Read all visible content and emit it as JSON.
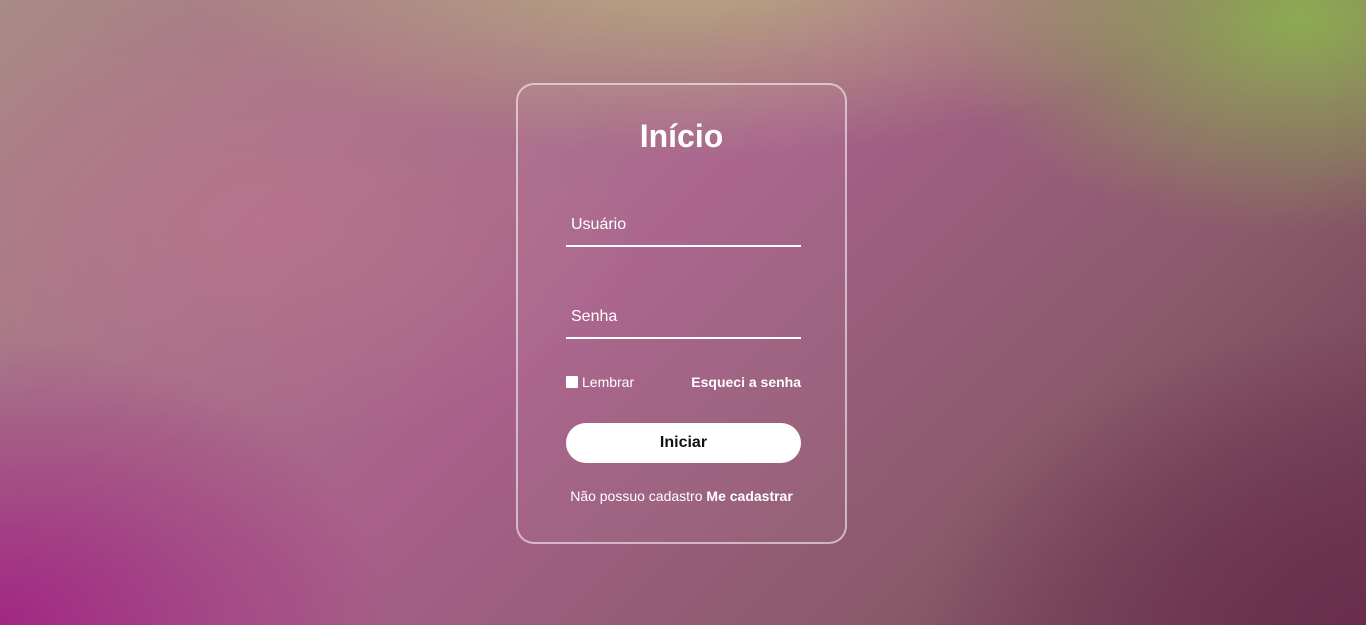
{
  "login": {
    "title": "Início",
    "username_placeholder": "Usuário",
    "password_placeholder": "Senha",
    "remember_label": "Lembrar",
    "remember_checked": false,
    "forgot_label": "Esqueci a senha",
    "submit_label": "Iniciar",
    "register_prompt": "Não possuo cadastro",
    "register_link": "Me cadastrar"
  },
  "colors": {
    "text": "#ffffff",
    "button_bg": "#ffffff",
    "button_text": "#111111"
  }
}
